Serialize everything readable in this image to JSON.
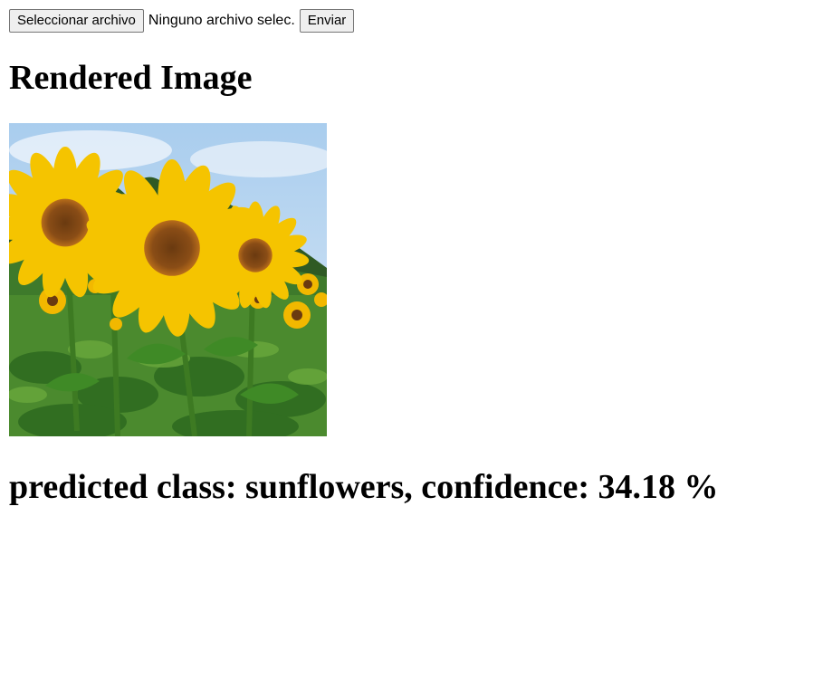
{
  "upload_form": {
    "choose_file_label": "Seleccionar archivo",
    "file_status": "Ninguno archivo selec.",
    "submit_label": "Enviar"
  },
  "heading": "Rendered Image",
  "image": {
    "subject": "sunflower field photo"
  },
  "result": {
    "text": "predicted class: sunflowers, confidence: 34.18 %"
  },
  "colors": {
    "page_background": "#ffffff",
    "button_background": "#efefef",
    "button_border": "#767676"
  }
}
